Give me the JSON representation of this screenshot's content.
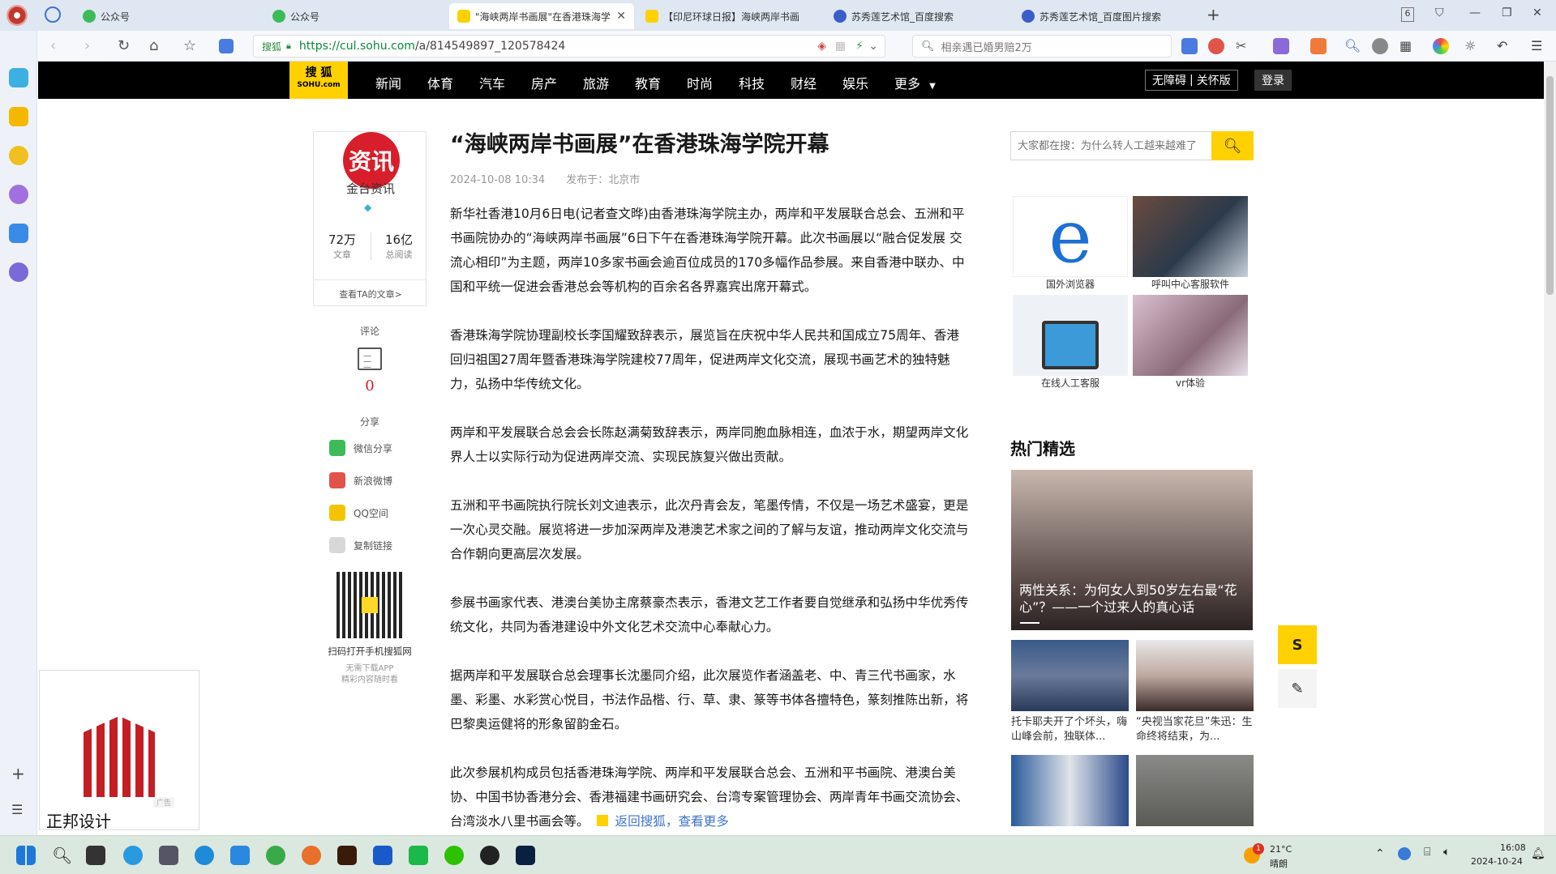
{
  "browser": {
    "tabs": [
      {
        "label": "公众号",
        "active": false
      },
      {
        "label": "公众号",
        "active": false
      },
      {
        "label": "\"海峡两岸书画展\"在香港珠海学",
        "active": true
      },
      {
        "label": "【印尼环球日报】海峡两岸书画",
        "active": false
      },
      {
        "label": "苏秀莲艺术馆_百度搜索",
        "active": false
      },
      {
        "label": "苏秀莲艺术馆_百度图片搜索",
        "active": false
      }
    ],
    "tab_count_badge": "6",
    "address": {
      "secure_label": "搜狐",
      "url_scheme_host": "https://cul.sohu.com",
      "url_path": "/a/814549897_120578424"
    },
    "search_placeholder": "相亲遇已婚男赔2万"
  },
  "sohu_nav": {
    "logo_line1": "搜 狐",
    "logo_line2": "SOHU.com",
    "items": [
      "新闻",
      "体育",
      "汽车",
      "房产",
      "旅游",
      "教育",
      "时尚",
      "科技",
      "财经",
      "娱乐",
      "更多"
    ],
    "accessibility": "无障碍",
    "elder": "关怀版",
    "login": "登录"
  },
  "author": {
    "avatar_text": "资讯",
    "name": "金台资讯",
    "articles_value": "72万",
    "articles_label": "文章",
    "reads_value": "16亿",
    "reads_label": "总阅读",
    "view_link": "查看TA的文章>"
  },
  "side_tools": {
    "comment_label": "评论",
    "comment_count": "0",
    "share_label": "分享",
    "share_items": [
      "微信分享",
      "新浪微博",
      "QQ空间",
      "复制链接"
    ],
    "qr_caption": "扫码打开手机搜狐网",
    "qr_sub1": "无需下载APP",
    "qr_sub2": "精彩内容随时看"
  },
  "article": {
    "title": "“海峡两岸书画展”在香港珠海学院开幕",
    "date": "2024-10-08 10:34",
    "published_in": "发布于：北京市",
    "paragraphs": [
      "新华社香港10月6日电(记者查文晔)由香港珠海学院主办，两岸和平发展联合总会、五洲和平书画院协办的“海峡两岸书画展”6日下午在香港珠海学院开幕。此次书画展以“融合促发展 交流心相印”为主题，两岸10多家书画会逾百位成员的170多幅作品参展。来自香港中联办、中国和平统一促进会香港总会等机构的百余名各界嘉宾出席开幕式。",
      "香港珠海学院协理副校长李国耀致辞表示，展览旨在庆祝中华人民共和国成立75周年、香港回归祖国27周年暨香港珠海学院建校77周年，促进两岸文化交流，展现书画艺术的独特魅力，弘扬中华传统文化。",
      "两岸和平发展联合总会会长陈赵满菊致辞表示，两岸同胞血脉相连，血浓于水，期望两岸文化界人士以实际行动为促进两岸交流、实现民族复兴做出贡献。",
      "五洲和平书画院执行院长刘文迪表示，此次丹青会友，笔墨传情，不仅是一场艺术盛宴，更是一次心灵交融。展览将进一步加深两岸及港澳艺术家之间的了解与友谊，推动两岸文化交流与合作朝向更高层次发展。",
      "参展书画家代表、港澳台美协主席蔡豪杰表示，香港文艺工作者要自觉继承和弘扬中华优秀传统文化，共同为香港建设中外文化艺术交流中心奉献心力。",
      "据两岸和平发展联合总会理事长沈墨同介绍，此次展览作者涵盖老、中、青三代书画家，水墨、彩墨、水彩赏心悦目，书法作品楷、行、草、隶、篆等书体各擅特色，篆刻推陈出新，将巴黎奥运健将的形象留韵金石。",
      "此次参展机构成员包括香港珠海学院、两岸和平发展联合总会、五洲和平书画院、港澳台美协、中国书协香港分会、香港福建书画研究会、台湾专案管理协会、两岸青年书画交流协会、台湾淡水八里书画会等。"
    ],
    "back_link": "返回搜狐，查看更多"
  },
  "right": {
    "search_placeholder": "大家都在搜：为什么转人工越来越难了",
    "ads": [
      "国外浏览器",
      "呼叫中心客服软件",
      "在线人工客服",
      "vr体验"
    ],
    "hot_title": "热门精选",
    "hot_main_caption": "两性关系：为何女人到50岁左右最“花心”？——一个过来人的真心话",
    "hot_items": [
      "托卡耶夫开了个坏头，嗨山峰会前，独联体...",
      "“央视当家花旦”朱迅：生命终将结束，为..."
    ]
  },
  "bottom_ad": {
    "label": "正邦设计",
    "tag": "广告"
  },
  "taskbar": {
    "weather_temp": "21°C",
    "weather_desc": "晴朗",
    "weather_badge": "1",
    "time": "16:08",
    "date": "2024-10-24"
  },
  "colors": {
    "sohu_yellow": "#ffd100",
    "nav_black": "#000000",
    "avatar_red": "#d71e2a",
    "link_blue": "#3f74c8"
  }
}
